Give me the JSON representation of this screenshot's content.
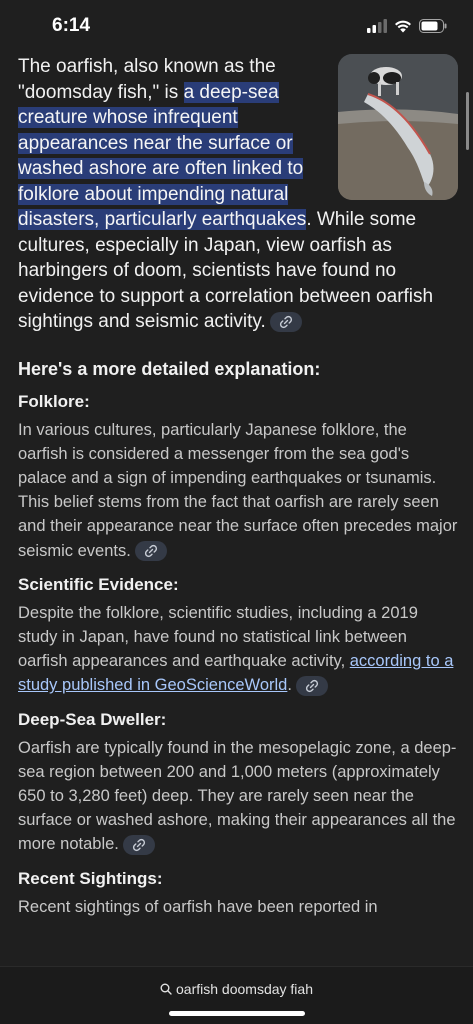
{
  "status": {
    "time": "6:14"
  },
  "intro": {
    "part1": "The oarfish, also known as the \"doomsday fish,\" is ",
    "highlight": "a deep-sea creature whose infrequent appearances near the surface or washed ashore are often linked to folklore about impending natural disasters, particularly earthquakes",
    "part2": ". While some cultures, especially in Japan, view oarfish as harbingers of doom, scientists have found no evidence to support a correlation between oarfish sightings and seismic activity."
  },
  "explanation_heading": "Here's a more detailed explanation:",
  "sections": {
    "folklore": {
      "title": "Folklore:",
      "text": "In various cultures, particularly Japanese folklore, the oarfish is considered a messenger from the sea god's palace and a sign of impending earthquakes or tsunamis. This belief stems from the fact that oarfish are rarely seen and their appearance near the surface often precedes major seismic events."
    },
    "scientific": {
      "title": "Scientific Evidence:",
      "text": "Despite the folklore, scientific studies, including a 2019 study in Japan, have found no statistical link between oarfish appearances and earthquake activity, ",
      "link": "according to a study published in GeoScienceWorld",
      "after_link": "."
    },
    "deepsea": {
      "title": "Deep-Sea Dweller:",
      "text": "Oarfish are typically found in the mesopelagic zone, a deep-sea region between 200 and 1,000 meters (approximately 650 to 3,280 feet) deep. They are rarely seen near the surface or washed ashore, making their appearances all the more notable."
    },
    "recent": {
      "title": "Recent Sightings:",
      "text": "Recent sightings of oarfish have been reported in"
    }
  },
  "bottom_bar": {
    "query": "oarfish doomsday fiah"
  },
  "colors": {
    "highlight": "#2a3d78",
    "link": "#a8c7fa",
    "chip": "#343a46"
  },
  "icons": [
    "cellular-icon",
    "wifi-icon",
    "battery-icon",
    "link-icon",
    "search-icon"
  ]
}
